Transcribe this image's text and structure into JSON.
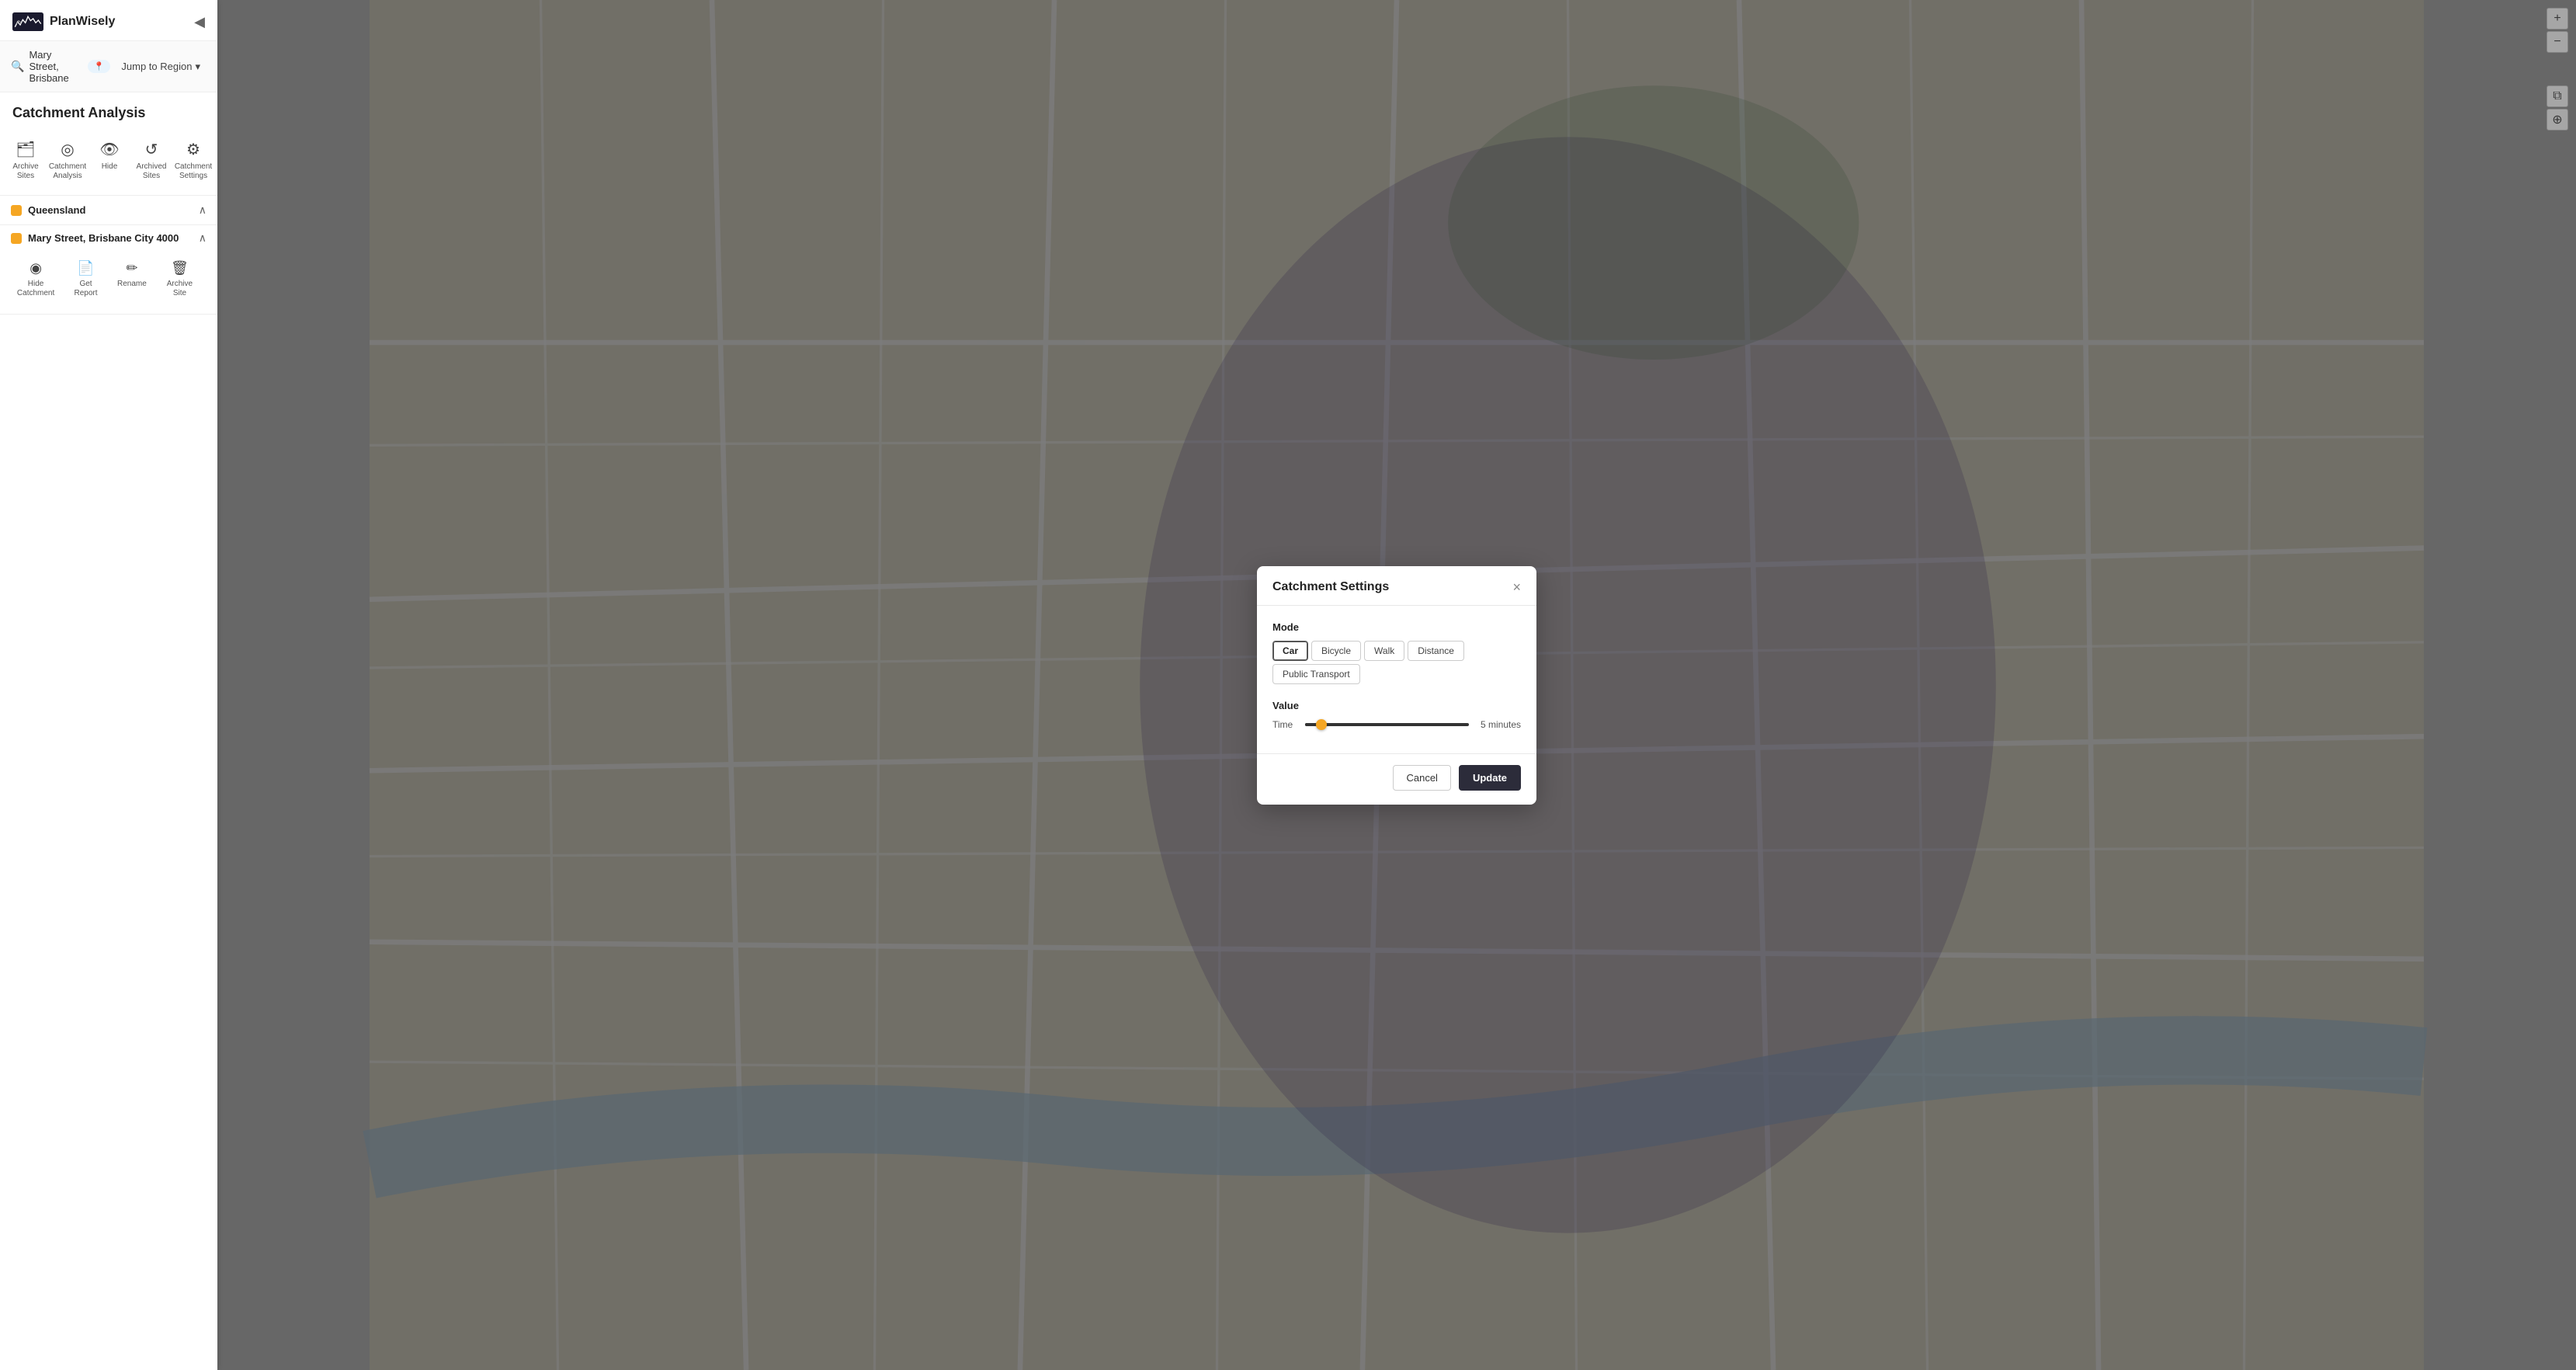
{
  "app": {
    "name": "PlanWisely"
  },
  "search": {
    "location": "Mary Street, Brisbane",
    "location_badge_icon": "📍",
    "jump_region_label": "Jump to Region",
    "jump_region_arrow": "▾"
  },
  "sidebar": {
    "section_title": "Catchment Analysis",
    "toolbar": [
      {
        "id": "archive-sites",
        "icon": "🗂",
        "label": "Archive\nSites"
      },
      {
        "id": "catchment-analysis",
        "icon": "◎",
        "label": "Catchment\nAnalysis"
      },
      {
        "id": "hide",
        "icon": "👁",
        "label": "Hide"
      },
      {
        "id": "archived-sites",
        "icon": "↺",
        "label": "Archived\nSites"
      },
      {
        "id": "catchment-settings",
        "icon": "⚙",
        "label": "Catchment\nSettings"
      }
    ],
    "region": {
      "name": "Queensland",
      "dot_color": "#f5a623"
    },
    "site": {
      "name": "Mary Street, Brisbane City 4000",
      "dot_color": "#f5a623",
      "actions": [
        {
          "id": "hide-catchment",
          "icon": "◉",
          "label": "Hide\nCatchment"
        },
        {
          "id": "get-report",
          "icon": "📄",
          "label": "Get Report"
        },
        {
          "id": "rename",
          "icon": "✏",
          "label": "Rename"
        },
        {
          "id": "archive-site",
          "icon": "🗑",
          "label": "Archive Site"
        }
      ]
    }
  },
  "modal": {
    "title": "Catchment Settings",
    "close_label": "×",
    "mode_label": "Mode",
    "modes": [
      {
        "id": "car",
        "label": "Car",
        "active": true
      },
      {
        "id": "bicycle",
        "label": "Bicycle",
        "active": false
      },
      {
        "id": "walk",
        "label": "Walk",
        "active": false
      },
      {
        "id": "distance",
        "label": "Distance",
        "active": false
      },
      {
        "id": "public-transport",
        "label": "Public Transport",
        "active": false
      }
    ],
    "value_label": "Value",
    "time_label": "Time",
    "time_value": "5 minutes",
    "slider_percent": 10,
    "cancel_label": "Cancel",
    "update_label": "Update"
  },
  "map_controls": {
    "zoom_in": "+",
    "zoom_out": "−",
    "layers_icon": "⧉",
    "compass_icon": "⊕",
    "fullscreen_icon": "⤢"
  }
}
